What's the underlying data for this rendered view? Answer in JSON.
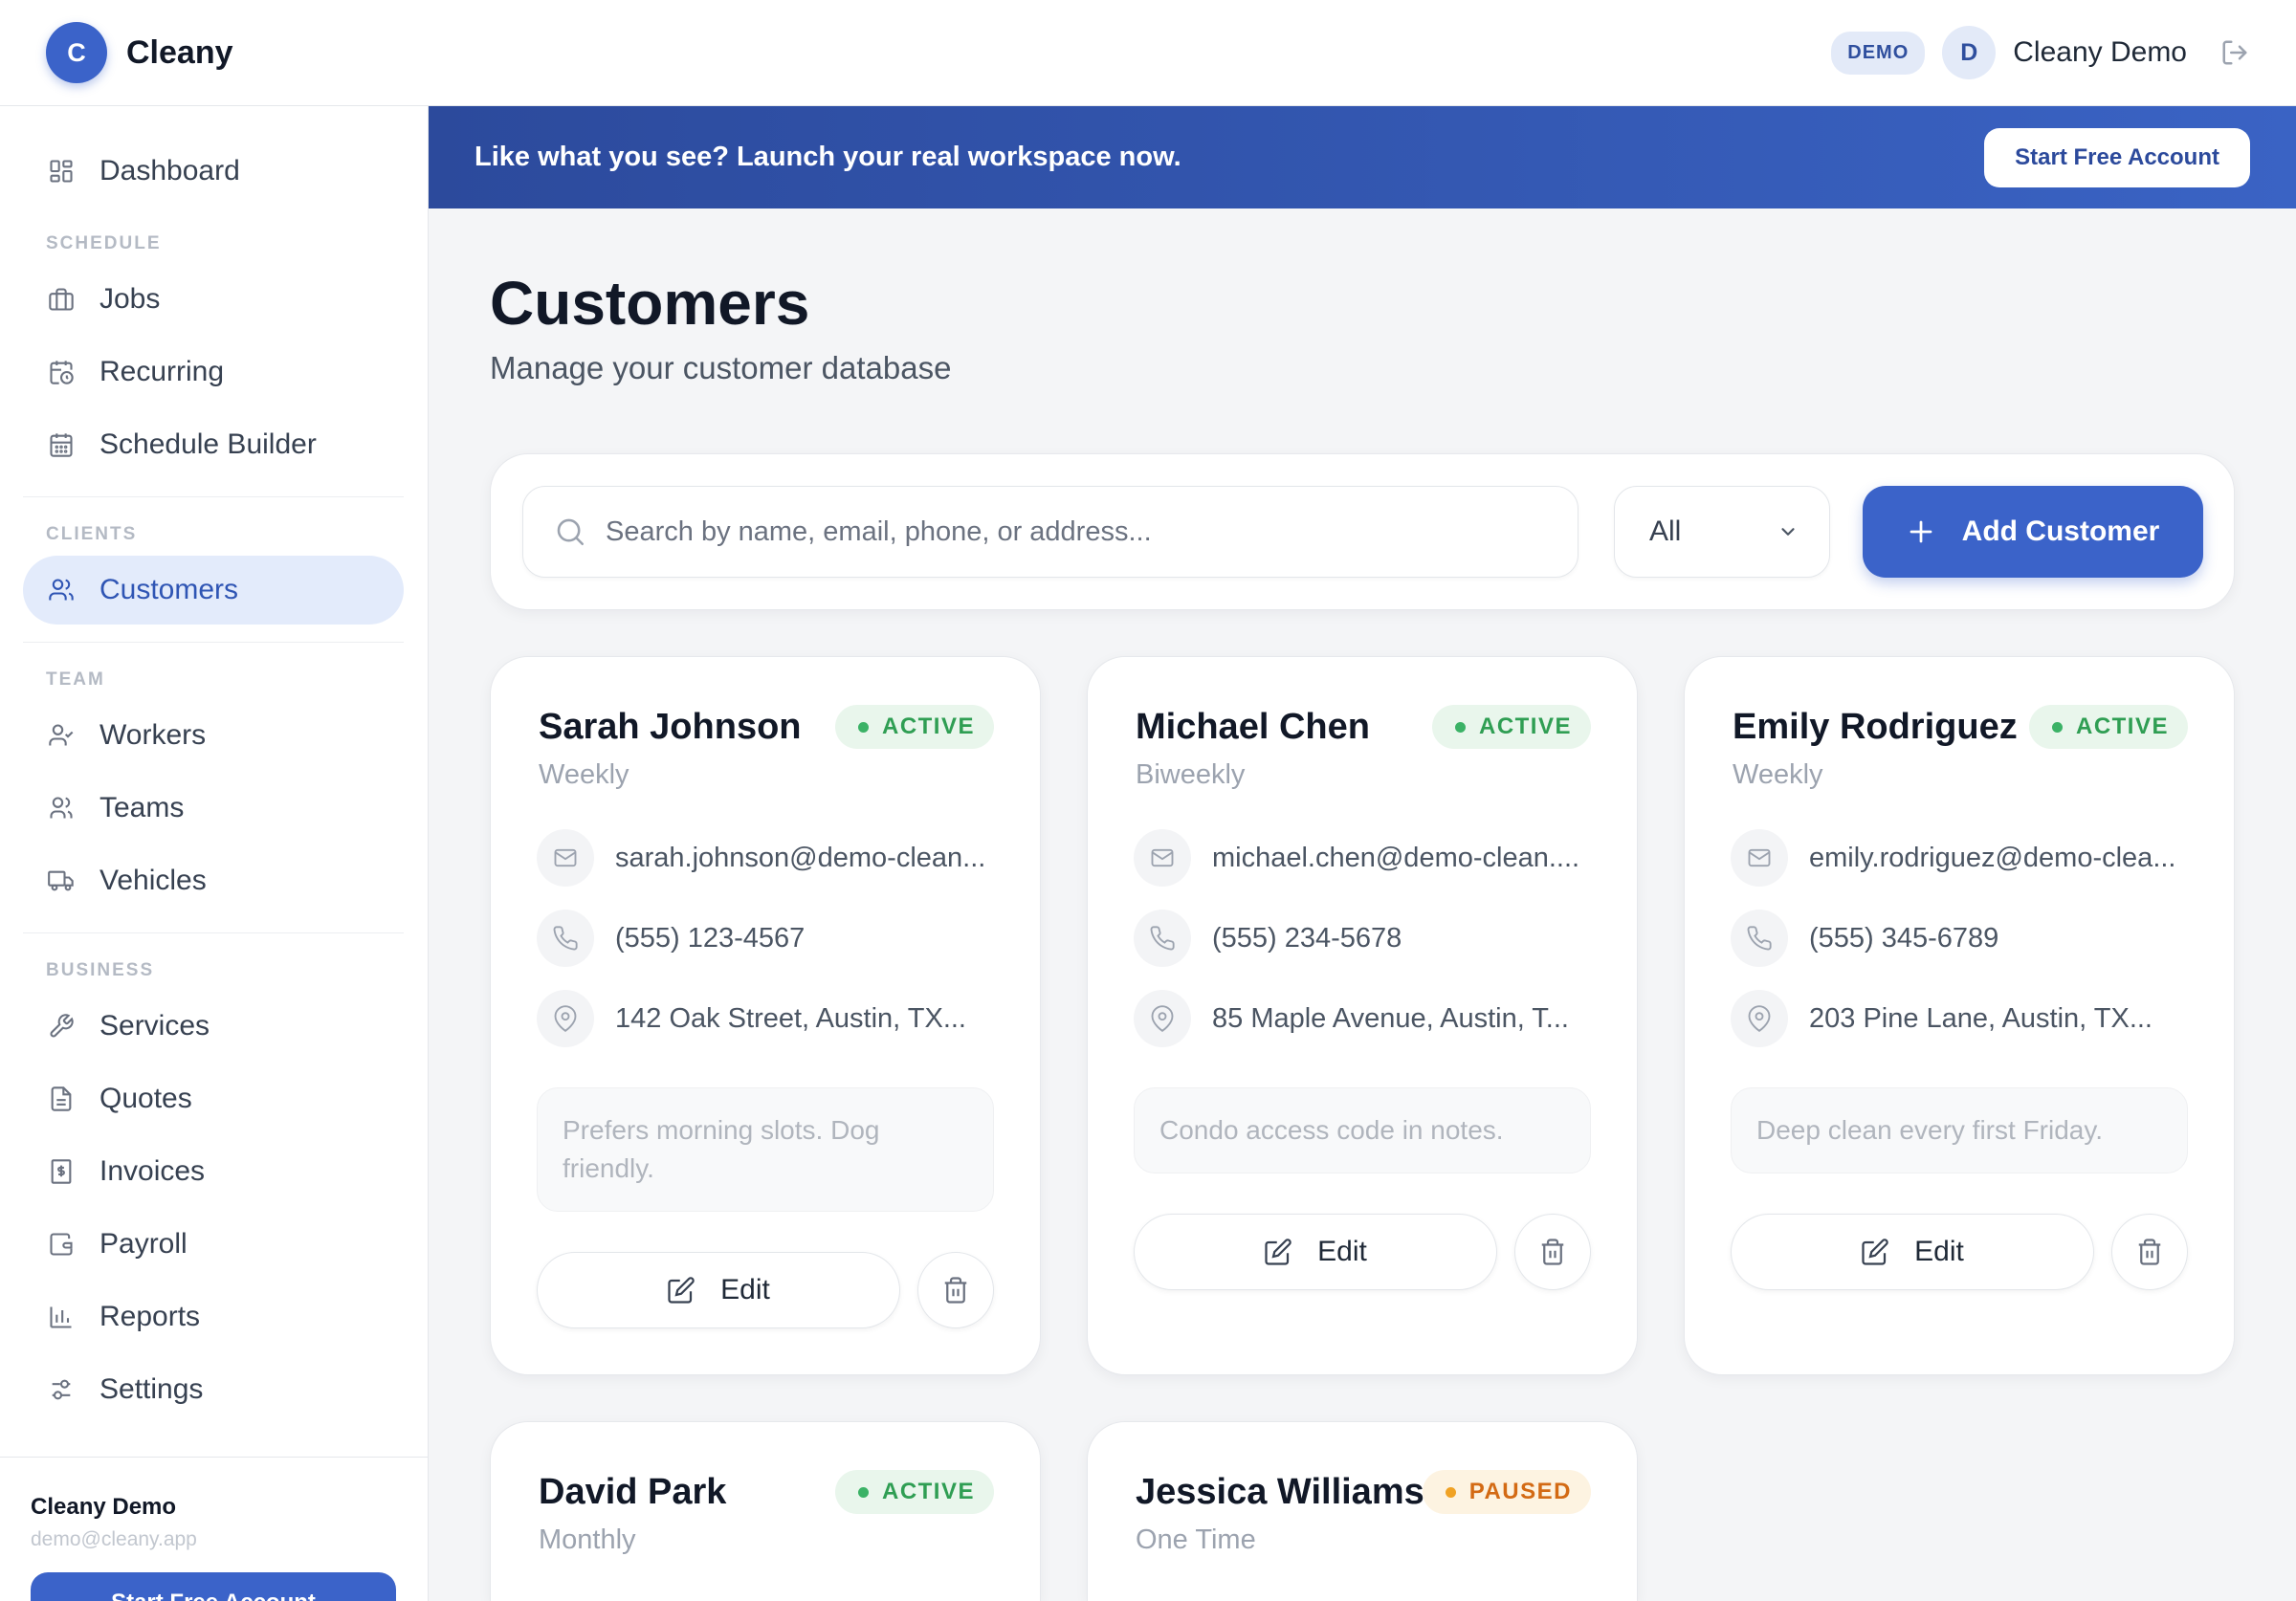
{
  "app": {
    "logo_letter": "C",
    "brand": "Cleany",
    "demo_badge": "DEMO",
    "user_initial": "D",
    "user_name": "Cleany Demo"
  },
  "sidebar": {
    "dashboard": "Dashboard",
    "sections": {
      "schedule": "SCHEDULE",
      "clients": "CLIENTS",
      "team": "TEAM",
      "business": "BUSINESS"
    },
    "items": {
      "jobs": "Jobs",
      "recurring": "Recurring",
      "schedule_builder": "Schedule Builder",
      "customers": "Customers",
      "workers": "Workers",
      "teams": "Teams",
      "vehicles": "Vehicles",
      "services": "Services",
      "quotes": "Quotes",
      "invoices": "Invoices",
      "payroll": "Payroll",
      "reports": "Reports",
      "settings": "Settings"
    },
    "footer": {
      "name": "Cleany Demo",
      "email": "demo@cleany.app",
      "button": "Start Free Account"
    }
  },
  "banner": {
    "text": "Like what you see? Launch your real workspace now.",
    "button": "Start Free Account"
  },
  "page": {
    "title": "Customers",
    "subtitle": "Manage your customer database"
  },
  "filters": {
    "search_placeholder": "Search by name, email, phone, or address...",
    "status_value": "All",
    "add_button": "Add Customer"
  },
  "customers": [
    {
      "name": "Sarah Johnson",
      "frequency": "Weekly",
      "status": "ACTIVE",
      "email": "sarah.johnson@demo-clean...",
      "phone": "(555) 123-4567",
      "address": "142 Oak Street, Austin, TX...",
      "note": "Prefers morning slots. Dog friendly.",
      "edit_label": "Edit"
    },
    {
      "name": "Michael Chen",
      "frequency": "Biweekly",
      "status": "ACTIVE",
      "email": "michael.chen@demo-clean....",
      "phone": "(555) 234-5678",
      "address": "85 Maple Avenue, Austin, T...",
      "note": "Condo access code in notes.",
      "edit_label": "Edit"
    },
    {
      "name": "Emily Rodriguez",
      "frequency": "Weekly",
      "status": "ACTIVE",
      "email": "emily.rodriguez@demo-clea...",
      "phone": "(555) 345-6789",
      "address": "203 Pine Lane, Austin, TX...",
      "note": "Deep clean every first Friday.",
      "edit_label": "Edit"
    },
    {
      "name": "David Park",
      "frequency": "Monthly",
      "status": "ACTIVE"
    },
    {
      "name": "Jessica Williams",
      "frequency": "One Time",
      "status": "PAUSED"
    }
  ],
  "colors": {
    "accent": "#3b63c9",
    "active_text": "#2f9e53",
    "paused_text": "#d36a14",
    "sidebar_active_bg": "#e3ebfb"
  }
}
